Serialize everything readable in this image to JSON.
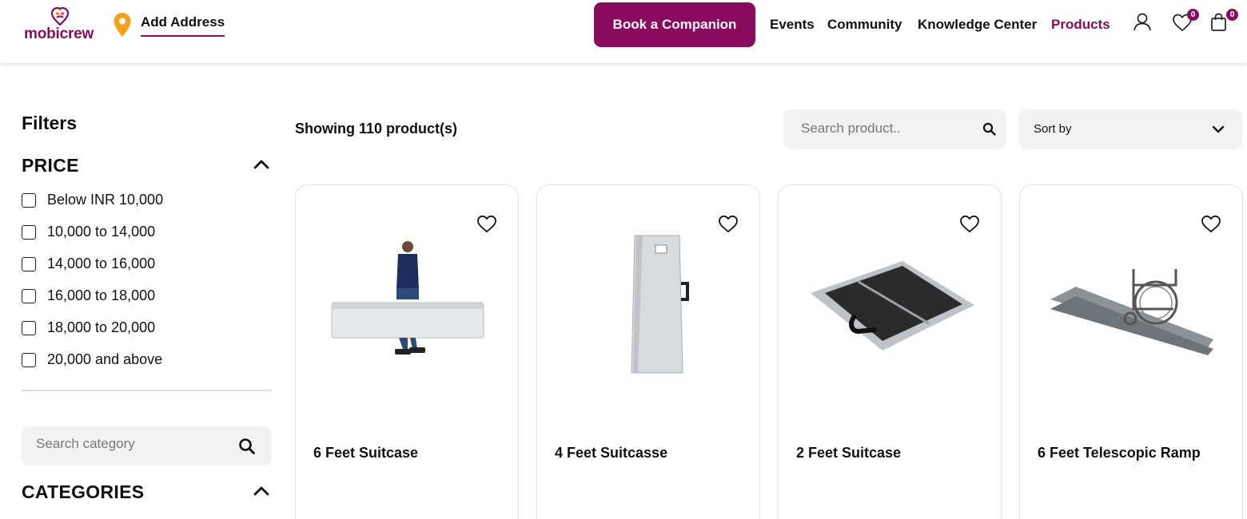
{
  "brand": {
    "name": "mobicrew",
    "color": "#8a0b5e"
  },
  "header": {
    "address_label": "Add Address",
    "cta_label": "Book a Companion",
    "nav": [
      {
        "label": "Events",
        "active": false
      },
      {
        "label": "Community",
        "active": false
      },
      {
        "label": "Knowledge Center",
        "active": false
      },
      {
        "label": "Products",
        "active": true
      }
    ],
    "icons": [
      "user-icon",
      "heart-icon",
      "bag-icon"
    ],
    "wishlist_count": "0",
    "cart_count": "0"
  },
  "sidebar": {
    "title": "Filters",
    "price": {
      "title": "PRICE",
      "options": [
        "Below INR 10,000",
        "10,000 to 14,000",
        "14,000 to 16,000",
        "16,000 to 18,000",
        "18,000 to 20,000",
        "20,000 and above"
      ]
    },
    "category_search_placeholder": "Search category",
    "categories_title": "CATEGORIES"
  },
  "main": {
    "showing": "Showing 110 product(s)",
    "search_placeholder": "Search product..",
    "sort_label": "Sort by",
    "products": [
      {
        "name": "6 Feet Suitcase"
      },
      {
        "name": "4 Feet Suitcasse"
      },
      {
        "name": "2 Feet Suitcase"
      },
      {
        "name": "6 Feet Telescopic Ramp"
      }
    ]
  }
}
